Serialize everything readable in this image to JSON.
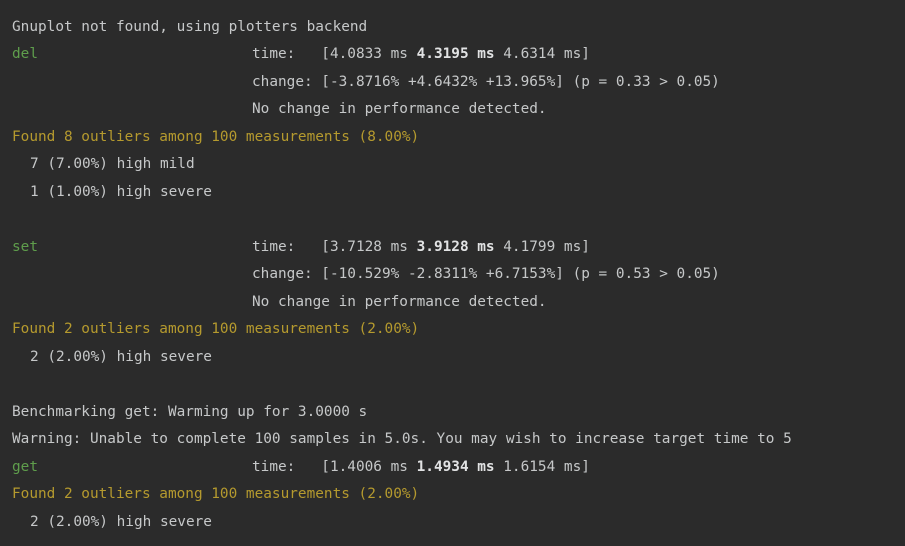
{
  "lines": {
    "gnuplot": "Gnuplot not found, using plotters backend",
    "del_name": "del",
    "del_time_label": "time:   [",
    "del_time_low": "4.0833 ms ",
    "del_time_mid": "4.3195 ms",
    "del_time_high": " 4.6314 ms]",
    "del_change": "change: [-3.8716% +4.6432% +13.965%] (p = 0.33 > 0.05)",
    "del_nochange": "No change in performance detected.",
    "del_found": "Found 8 outliers among 100 measurements (8.00%)",
    "del_mild": "7 (7.00%) high mild",
    "del_severe": "1 (1.00%) high severe",
    "set_name": "set",
    "set_time_label": "time:   [",
    "set_time_low": "3.7128 ms ",
    "set_time_mid": "3.9128 ms",
    "set_time_high": " 4.1799 ms]",
    "set_change": "change: [-10.529% -2.8311% +6.7153%] (p = 0.53 > 0.05)",
    "set_nochange": "No change in performance detected.",
    "set_found": "Found 2 outliers among 100 measurements (2.00%)",
    "set_severe": "2 (2.00%) high severe",
    "bench_get": "Benchmarking get: Warming up for 3.0000 s",
    "warning": "Warning: Unable to complete 100 samples in 5.0s. You may wish to increase target time to 5",
    "get_name": "get",
    "get_time_label": "time:   [",
    "get_time_low": "1.4006 ms ",
    "get_time_mid": "1.4934 ms",
    "get_time_high": " 1.6154 ms]",
    "get_found": "Found 2 outliers among 100 measurements (2.00%)",
    "get_severe": "2 (2.00%) high severe"
  },
  "colors": {
    "background": "#2b2b2b",
    "text": "#c6c8c9",
    "name": "#5f9e4c",
    "found": "#b59a2e"
  }
}
